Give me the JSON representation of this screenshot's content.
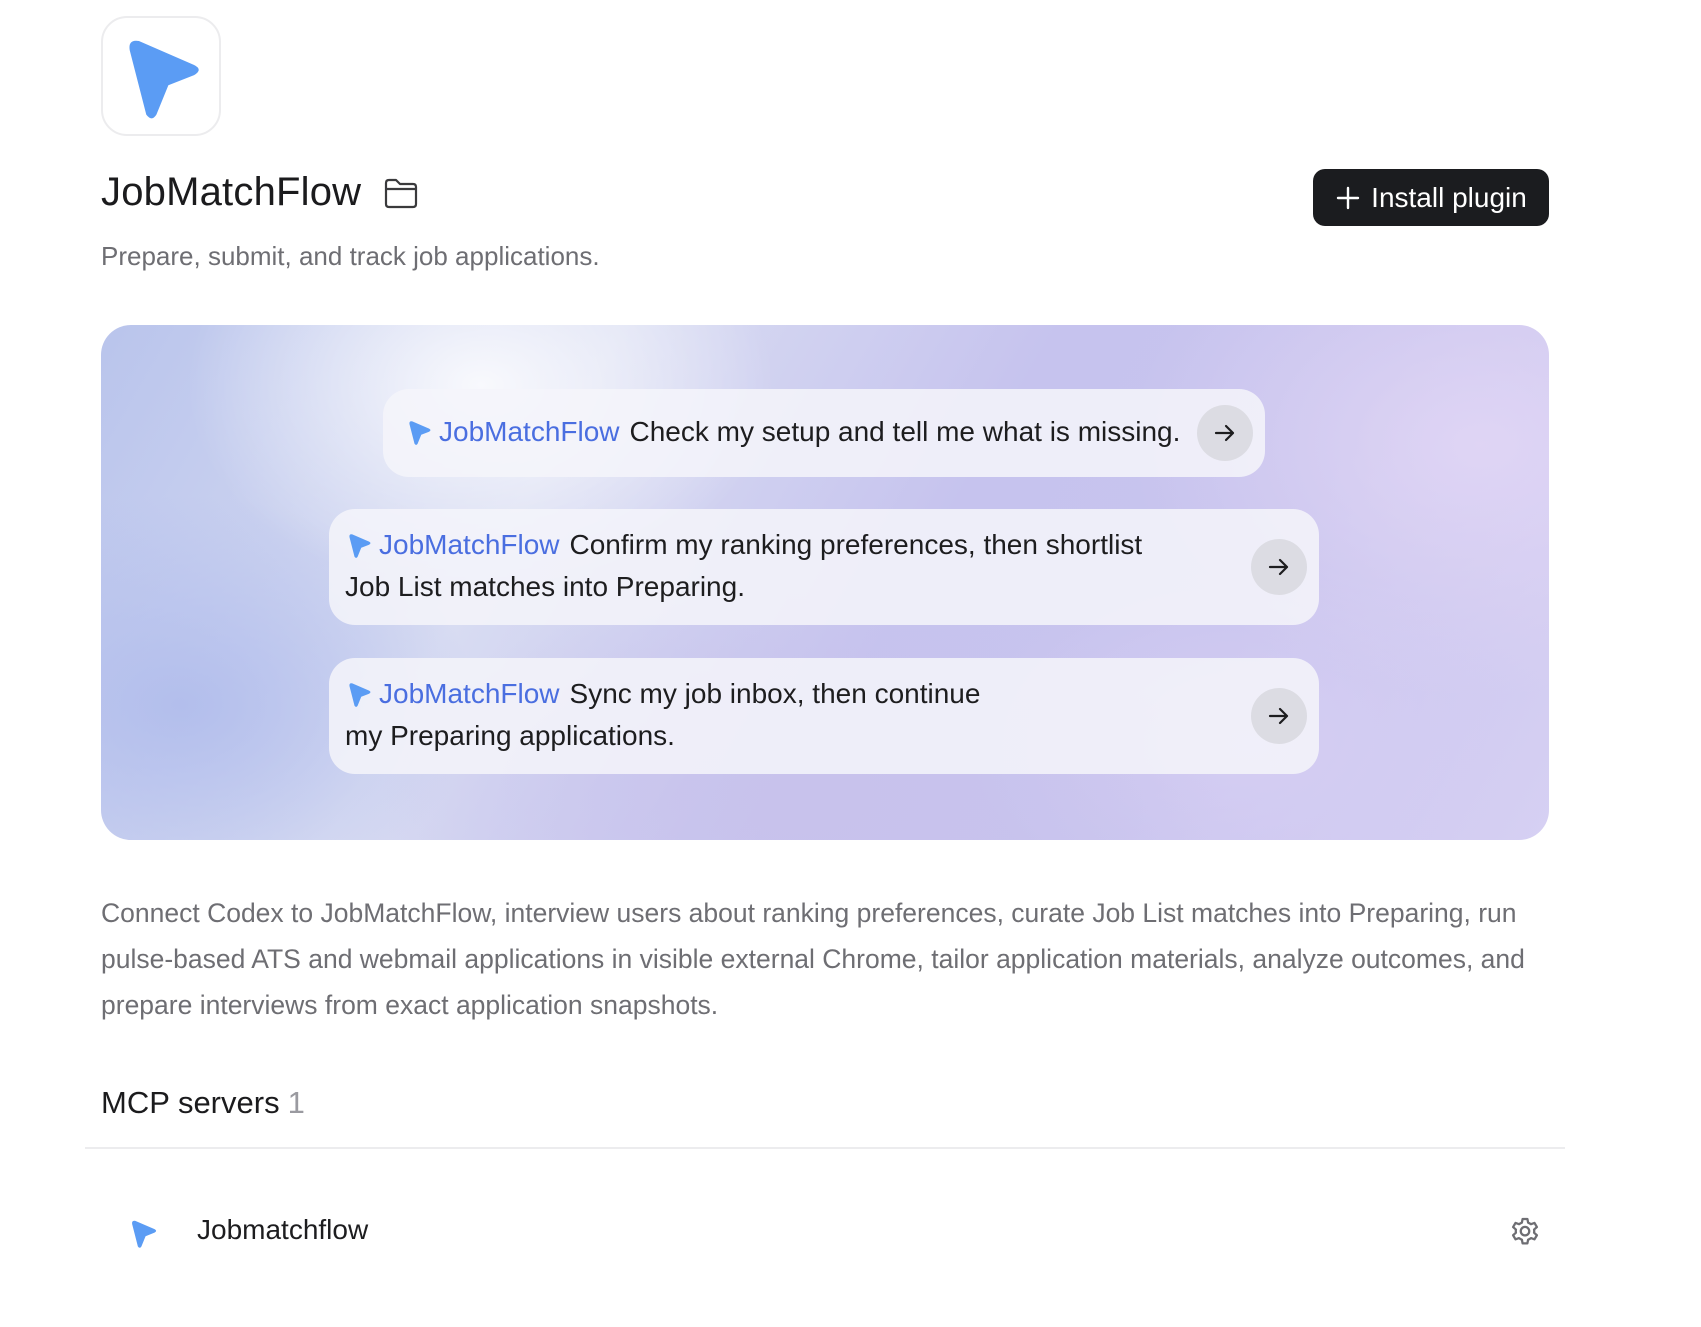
{
  "app": {
    "name": "JobMatchFlow",
    "tagline": "Prepare, submit, and track job applications.",
    "accent_color": "#5b9cf4",
    "logo_icon": "navigation-arrow-icon",
    "folder_icon": "folder-icon"
  },
  "actions": {
    "install_label": "Install plugin",
    "install_icon": "plus-icon"
  },
  "hero": {
    "prompts": [
      {
        "tag": "JobMatchFlow",
        "text": "Check my setup and tell me what is missing.",
        "icon": "arrow-right-icon"
      },
      {
        "tag": "JobMatchFlow",
        "text": "Confirm my ranking preferences, then shortlist Job List matches into Preparing.",
        "icon": "arrow-right-icon"
      },
      {
        "tag": "JobMatchFlow",
        "text": "Sync my job inbox, then continue my Preparing applications.",
        "icon": "arrow-right-icon"
      }
    ]
  },
  "description": "Connect Codex to JobMatchFlow, interview users about ranking preferences, curate Job List matches into Preparing, run pulse-based ATS and webmail applications in visible external Chrome, tailor application materials, analyze outcomes, and prepare interviews from exact application snapshots.",
  "mcp": {
    "title": "MCP servers",
    "count": "1",
    "servers": [
      {
        "name": "Jobmatchflow",
        "settings_icon": "gear-icon"
      }
    ]
  }
}
